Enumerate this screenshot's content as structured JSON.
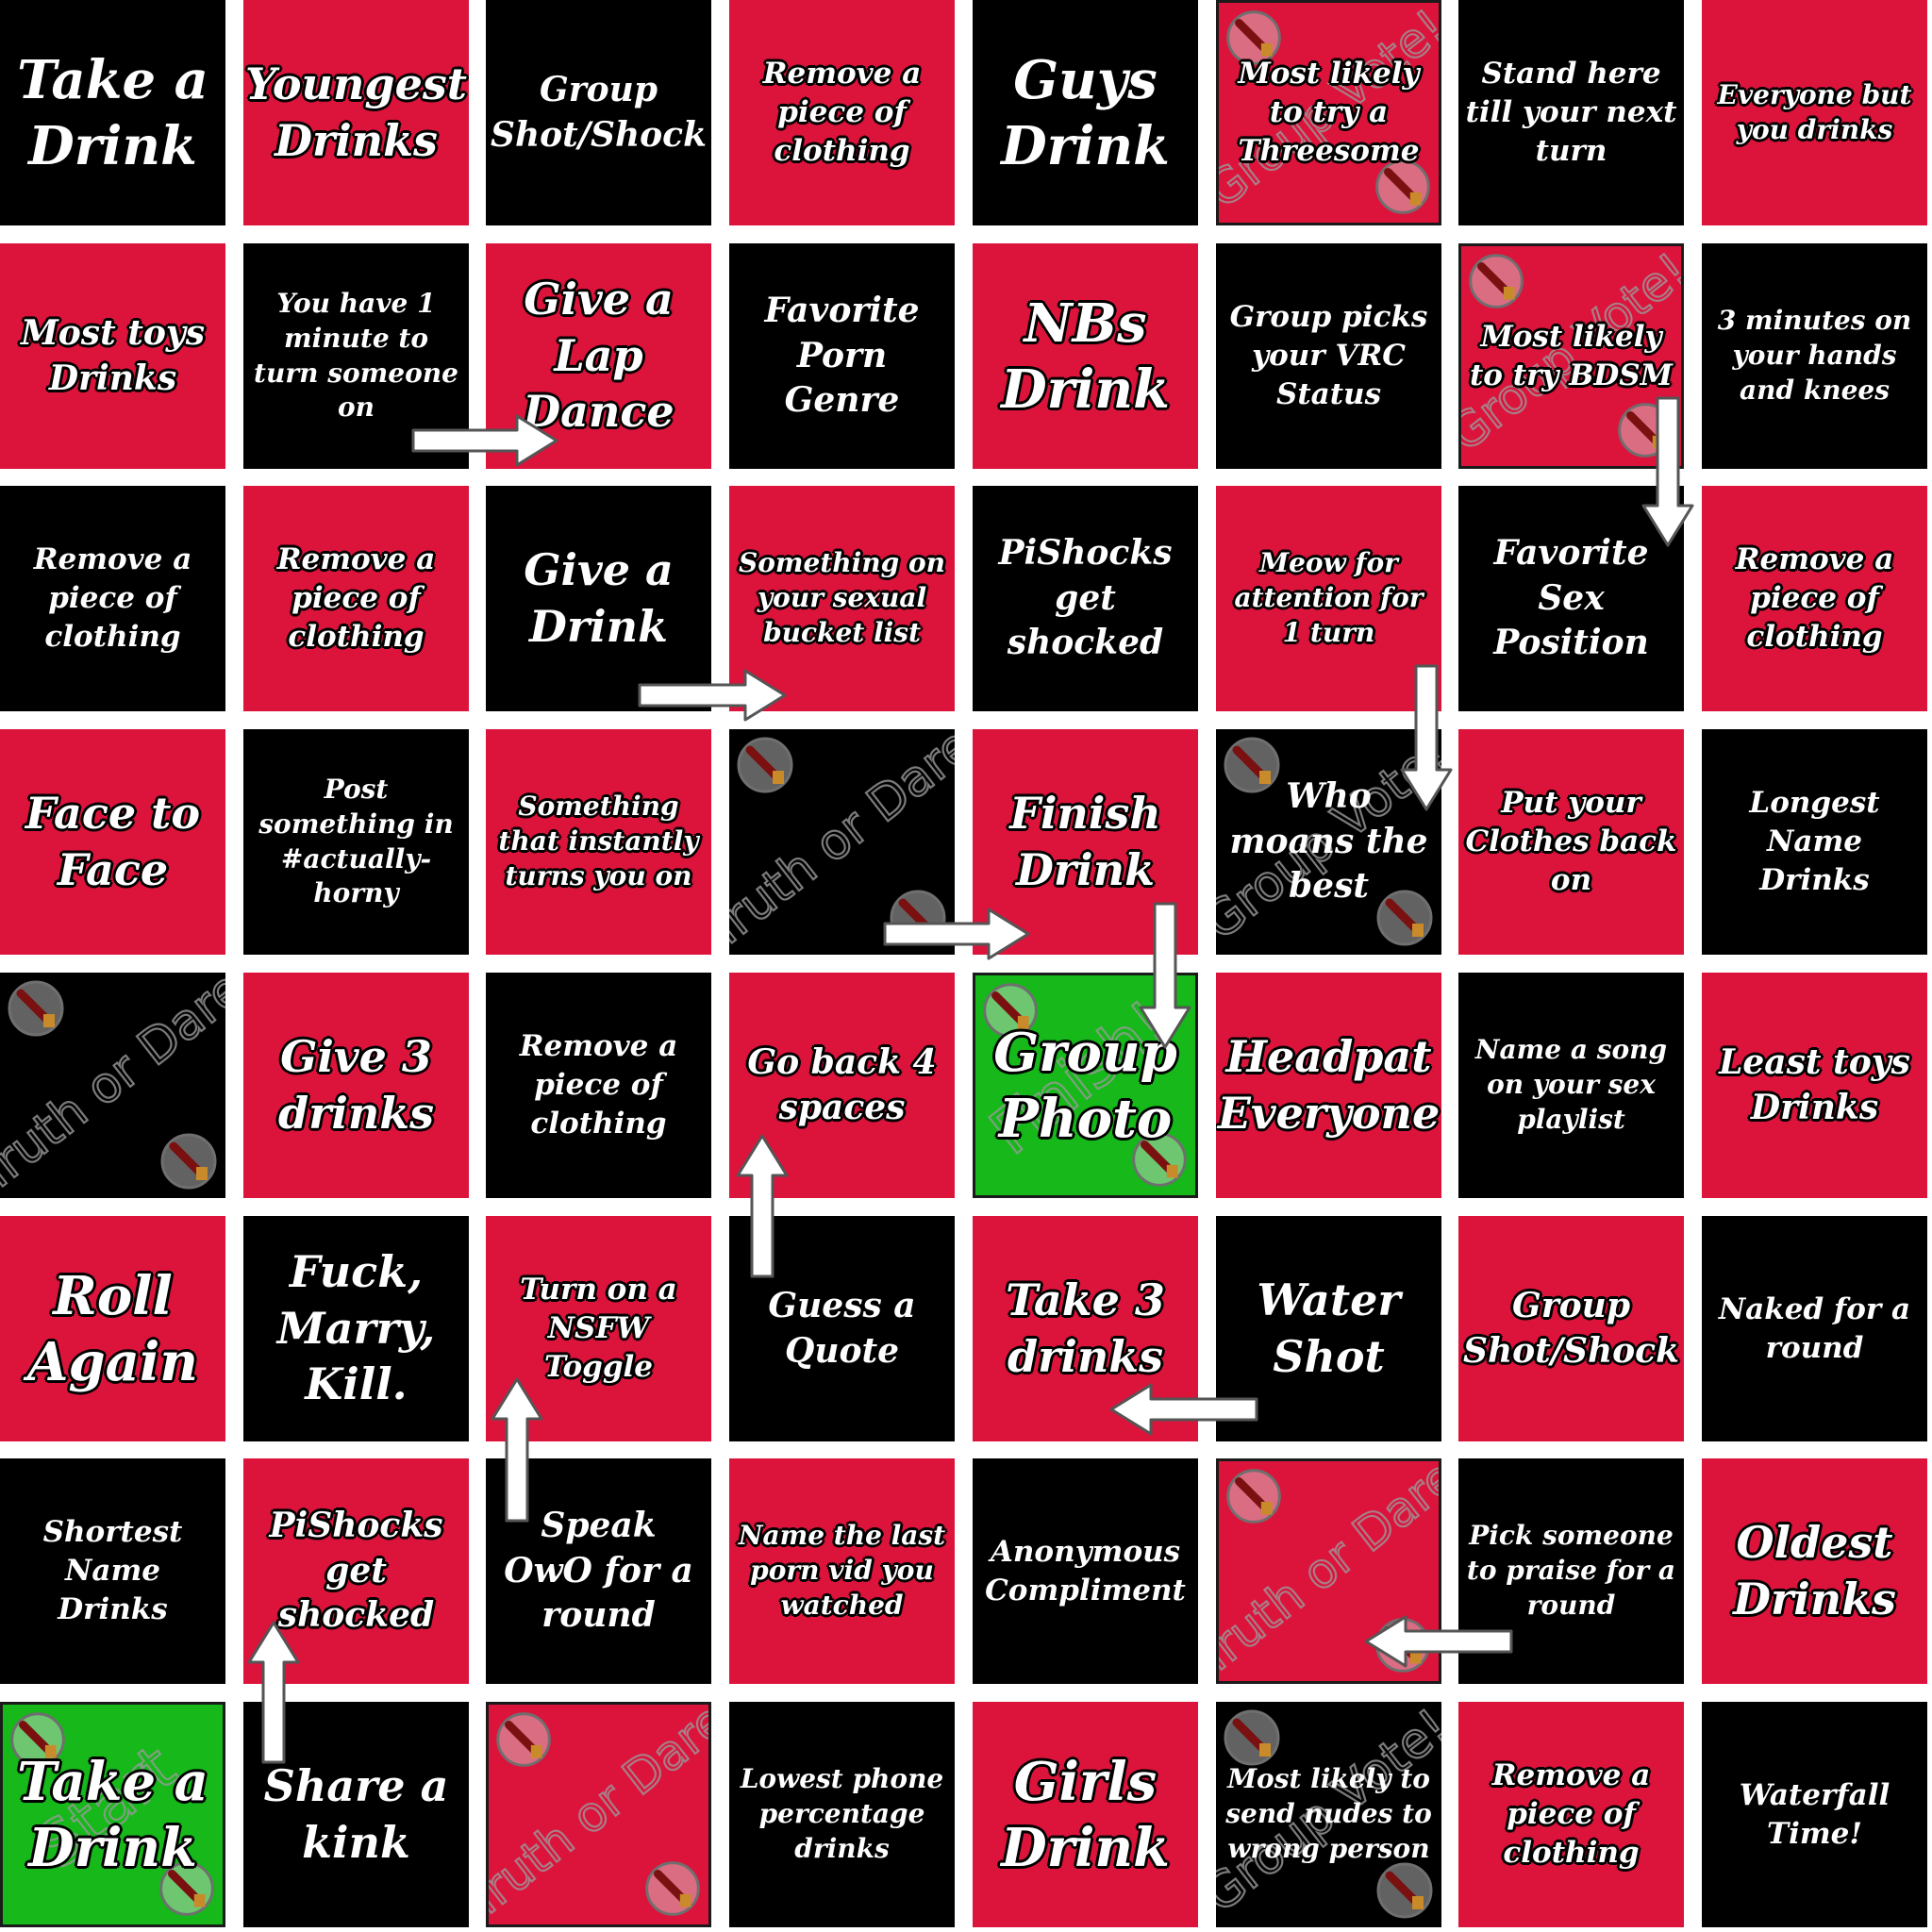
{
  "board": {
    "colors": {
      "red": "#dc143c",
      "black": "#000000",
      "green": "#16b81a",
      "background": "#ffffff"
    },
    "watermark_icon": "paddle-badge-icon",
    "arrow_icon": "white-arrow-icon",
    "rows": [
      [
        {
          "text": "Take a Drink",
          "color": "black",
          "size": "xl"
        },
        {
          "text": "Youngest Drinks",
          "color": "red",
          "size": "l"
        },
        {
          "text": "Group Shot/Shock",
          "color": "black",
          "size": "m"
        },
        {
          "text": "Remove a piece of clothing",
          "color": "red",
          "size": "s"
        },
        {
          "text": "Guys Drink",
          "color": "black",
          "size": "xl"
        },
        {
          "text": "Most likely to try a Threesome",
          "color": "red",
          "size": "s",
          "bordered": true,
          "watermark": "Group Vote!"
        },
        {
          "text": "Stand here till your next turn",
          "color": "black",
          "size": "s"
        },
        {
          "text": "Everyone but you drinks",
          "color": "red",
          "size": "xs"
        }
      ],
      [
        {
          "text": "Most toys Drinks",
          "color": "red",
          "size": "m"
        },
        {
          "text": "You have 1 minute to turn someone on",
          "color": "black",
          "size": "xs"
        },
        {
          "text": "Give a Lap Dance",
          "color": "red",
          "size": "l"
        },
        {
          "text": "Favorite Porn Genre",
          "color": "black",
          "size": "m"
        },
        {
          "text": "NBs Drink",
          "color": "red",
          "size": "xl"
        },
        {
          "text": "Group picks your VRC Status",
          "color": "black",
          "size": "s"
        },
        {
          "text": "Most likely to try BDSM",
          "color": "red",
          "size": "s",
          "bordered": true,
          "watermark": "Group Vote!"
        },
        {
          "text": "3 minutes on your hands and knees",
          "color": "black",
          "size": "xs"
        }
      ],
      [
        {
          "text": "Remove a piece of clothing",
          "color": "black",
          "size": "s"
        },
        {
          "text": "Remove a piece of clothing",
          "color": "red",
          "size": "s"
        },
        {
          "text": "Give a Drink",
          "color": "black",
          "size": "l"
        },
        {
          "text": "Something on your sexual bucket list",
          "color": "red",
          "size": "xs"
        },
        {
          "text": "PiShocks get shocked",
          "color": "black",
          "size": "m"
        },
        {
          "text": "Meow for attention for 1 turn",
          "color": "red",
          "size": "xs"
        },
        {
          "text": "Favorite Sex Position",
          "color": "black",
          "size": "m"
        },
        {
          "text": "Remove a piece of clothing",
          "color": "red",
          "size": "s"
        }
      ],
      [
        {
          "text": "Face to Face",
          "color": "red",
          "size": "l"
        },
        {
          "text": "Post something in #actually-horny",
          "color": "black",
          "size": "xs"
        },
        {
          "text": "Something that instantly turns you on",
          "color": "red",
          "size": "xs"
        },
        {
          "text": "",
          "color": "black",
          "size": "s",
          "watermark": "Truth or Dare"
        },
        {
          "text": "Finish Drink",
          "color": "red",
          "size": "l"
        },
        {
          "text": "Who moans the best",
          "color": "black",
          "size": "m",
          "watermark": "Group Vote!"
        },
        {
          "text": "Put your Clothes back on",
          "color": "red",
          "size": "s"
        },
        {
          "text": "Longest Name Drinks",
          "color": "black",
          "size": "s"
        }
      ],
      [
        {
          "text": "",
          "color": "black",
          "size": "s",
          "watermark": "Truth or Dare"
        },
        {
          "text": "Give 3 drinks",
          "color": "red",
          "size": "l"
        },
        {
          "text": "Remove a piece of clothing",
          "color": "black",
          "size": "s"
        },
        {
          "text": "Go back 4 spaces",
          "color": "red",
          "size": "m"
        },
        {
          "text": "Group Photo",
          "color": "green",
          "size": "xl",
          "bordered": true,
          "watermark": "Finish!"
        },
        {
          "text": "Headpat Everyone",
          "color": "red",
          "size": "l"
        },
        {
          "text": "Name a song on your sex playlist",
          "color": "black",
          "size": "xs"
        },
        {
          "text": "Least toys Drinks",
          "color": "red",
          "size": "m"
        }
      ],
      [
        {
          "text": "Roll Again",
          "color": "red",
          "size": "xl"
        },
        {
          "text": "Fuck, Marry, Kill.",
          "color": "black",
          "size": "l"
        },
        {
          "text": "Turn on a NSFW Toggle",
          "color": "red",
          "size": "s"
        },
        {
          "text": "Guess a Quote",
          "color": "black",
          "size": "m"
        },
        {
          "text": "Take 3 drinks",
          "color": "red",
          "size": "l"
        },
        {
          "text": "Water Shot",
          "color": "black",
          "size": "l"
        },
        {
          "text": "Group Shot/Shock",
          "color": "red",
          "size": "m"
        },
        {
          "text": "Naked for a round",
          "color": "black",
          "size": "s"
        }
      ],
      [
        {
          "text": "Shortest Name Drinks",
          "color": "black",
          "size": "s"
        },
        {
          "text": "PiShocks get shocked",
          "color": "red",
          "size": "m"
        },
        {
          "text": "Speak OwO for a round",
          "color": "black",
          "size": "m"
        },
        {
          "text": "Name the last porn vid you watched",
          "color": "red",
          "size": "xs"
        },
        {
          "text": "Anonymous Compliment",
          "color": "black",
          "size": "s"
        },
        {
          "text": "",
          "color": "red",
          "size": "s",
          "bordered": true,
          "watermark": "Truth or Dare"
        },
        {
          "text": "Pick someone to praise for a round",
          "color": "black",
          "size": "xs"
        },
        {
          "text": "Oldest Drinks",
          "color": "red",
          "size": "l"
        }
      ],
      [
        {
          "text": "Take a Drink",
          "color": "green",
          "size": "xl",
          "bordered": true,
          "watermark": "Start"
        },
        {
          "text": "Share a kink",
          "color": "black",
          "size": "l"
        },
        {
          "text": "",
          "color": "red",
          "size": "s",
          "bordered": true,
          "watermark": "Truth or Dare"
        },
        {
          "text": "Lowest phone percentage drinks",
          "color": "black",
          "size": "xs"
        },
        {
          "text": "Girls Drink",
          "color": "red",
          "size": "xl"
        },
        {
          "text": "Most likely to send nudes to wrong person",
          "color": "black",
          "size": "xs",
          "watermark": "Group Vote!"
        },
        {
          "text": "Remove a piece of clothing",
          "color": "red",
          "size": "s"
        },
        {
          "text": "Waterfall Time!",
          "color": "black",
          "size": "s"
        }
      ]
    ]
  }
}
